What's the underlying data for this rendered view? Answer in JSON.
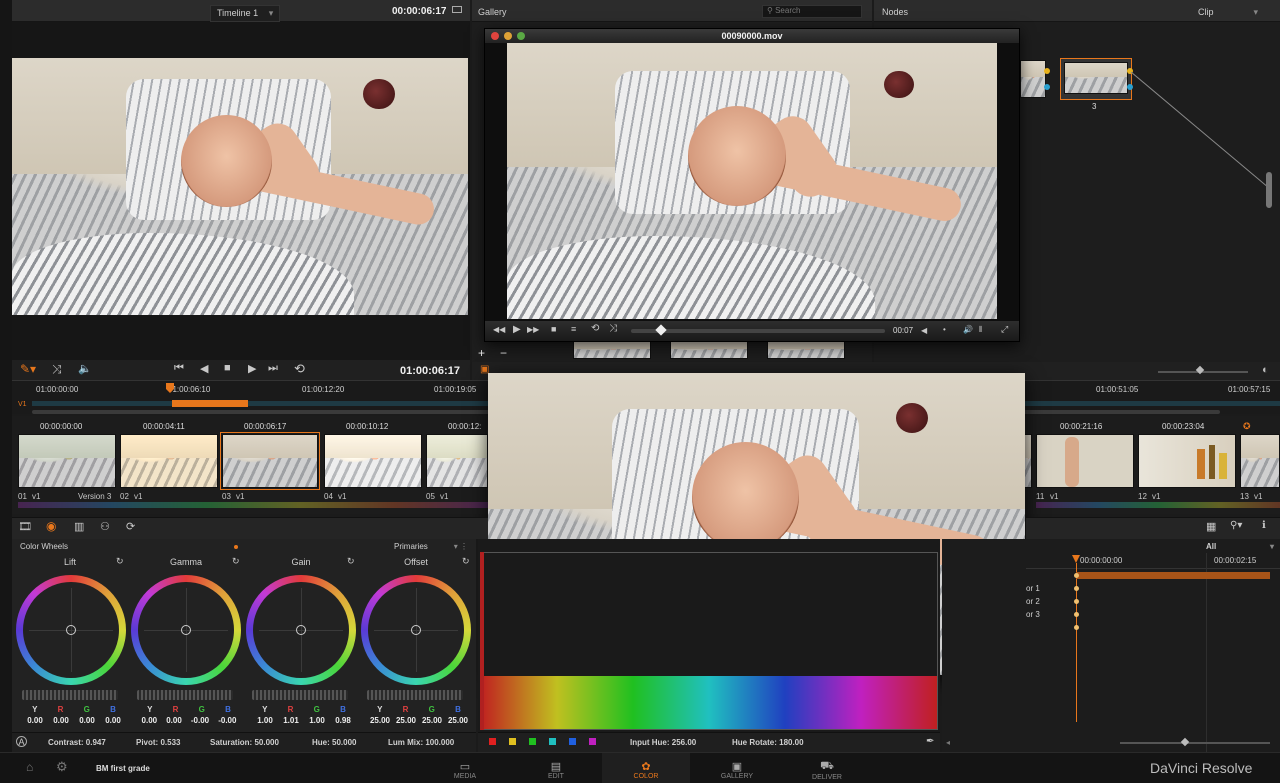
{
  "viewer": {
    "timeline_name": "Timeline 1",
    "timecode_top": "00:00:06:17",
    "timecode_bottom": "01:00:06:17"
  },
  "gallery": {
    "title": "Gallery",
    "search_placeholder": "Search"
  },
  "nodes": {
    "title": "Nodes",
    "mode": "Clip",
    "node_label": "3"
  },
  "player_window": {
    "title": "00090000.mov",
    "time": "00:07"
  },
  "timeline_ruler": {
    "marks": [
      "01:00:00:00",
      "01:00:06:10",
      "01:00:12:20",
      "01:00:19:05",
      "01:00:51:05",
      "01:00:57:15"
    ],
    "track_label": "V1"
  },
  "clips": [
    {
      "timecode": "00:00:00:00",
      "num": "01",
      "track": "V1",
      "version": "Version 3"
    },
    {
      "timecode": "00:00:04:11",
      "num": "02",
      "track": "V1",
      "version": ""
    },
    {
      "timecode": "00:00:06:17",
      "num": "03",
      "track": "V1",
      "version": ""
    },
    {
      "timecode": "00:00:10:12",
      "num": "04",
      "track": "V1",
      "version": ""
    },
    {
      "timecode": "00:00:12:",
      "num": "05",
      "track": "V1",
      "version": ""
    },
    {
      "timecode": "00:00:21:16",
      "num": "11",
      "track": "V1",
      "version": ""
    },
    {
      "timecode": "00:00:23:04",
      "num": "12",
      "track": "V1",
      "version": ""
    },
    {
      "timecode": "",
      "num": "13",
      "track": "V1",
      "version": ""
    }
  ],
  "color_wheels": {
    "title": "Color Wheels",
    "mode": "Primaries",
    "wheels": [
      {
        "name": "Lift",
        "y": "0.00",
        "r": "0.00",
        "g": "0.00",
        "b": "0.00"
      },
      {
        "name": "Gamma",
        "y": "0.00",
        "r": "0.00",
        "g": "-0.00",
        "b": "-0.00"
      },
      {
        "name": "Gain",
        "y": "1.00",
        "r": "1.01",
        "g": "1.00",
        "b": "0.98"
      },
      {
        "name": "Offset",
        "y": "25.00",
        "r": "25.00",
        "g": "25.00",
        "b": "25.00"
      }
    ],
    "channel_labels": {
      "y": "Y",
      "r": "R",
      "g": "G",
      "b": "B"
    },
    "contrast": "Contrast: 0.947",
    "pivot": "Pivot: 0.533",
    "saturation": "Saturation: 50.000",
    "hue": "Hue: 50.000",
    "lum_mix": "Lum Mix: 100.000"
  },
  "curves": {
    "input_hue": "Input Hue: 256.00",
    "hue_rotate": "Hue Rotate: 180.00",
    "swatches": [
      "#e02020",
      "#e0c020",
      "#20c020",
      "#20c0c0",
      "#2060e0",
      "#c020c0"
    ]
  },
  "keyframes": {
    "filter": "All",
    "start": "00:00:00:00",
    "end": "00:00:02:15",
    "tracks": [
      "or 1",
      "or 2",
      "or 3"
    ]
  },
  "bottom_bar": {
    "project": "BM first grade",
    "tabs": [
      "MEDIA",
      "EDIT",
      "COLOR",
      "GALLERY",
      "DELIVER"
    ],
    "brand": "DaVinci Resolve"
  },
  "colors": {
    "accent": "#e8771c",
    "panel": "#232323",
    "background": "#1b1b1b"
  }
}
